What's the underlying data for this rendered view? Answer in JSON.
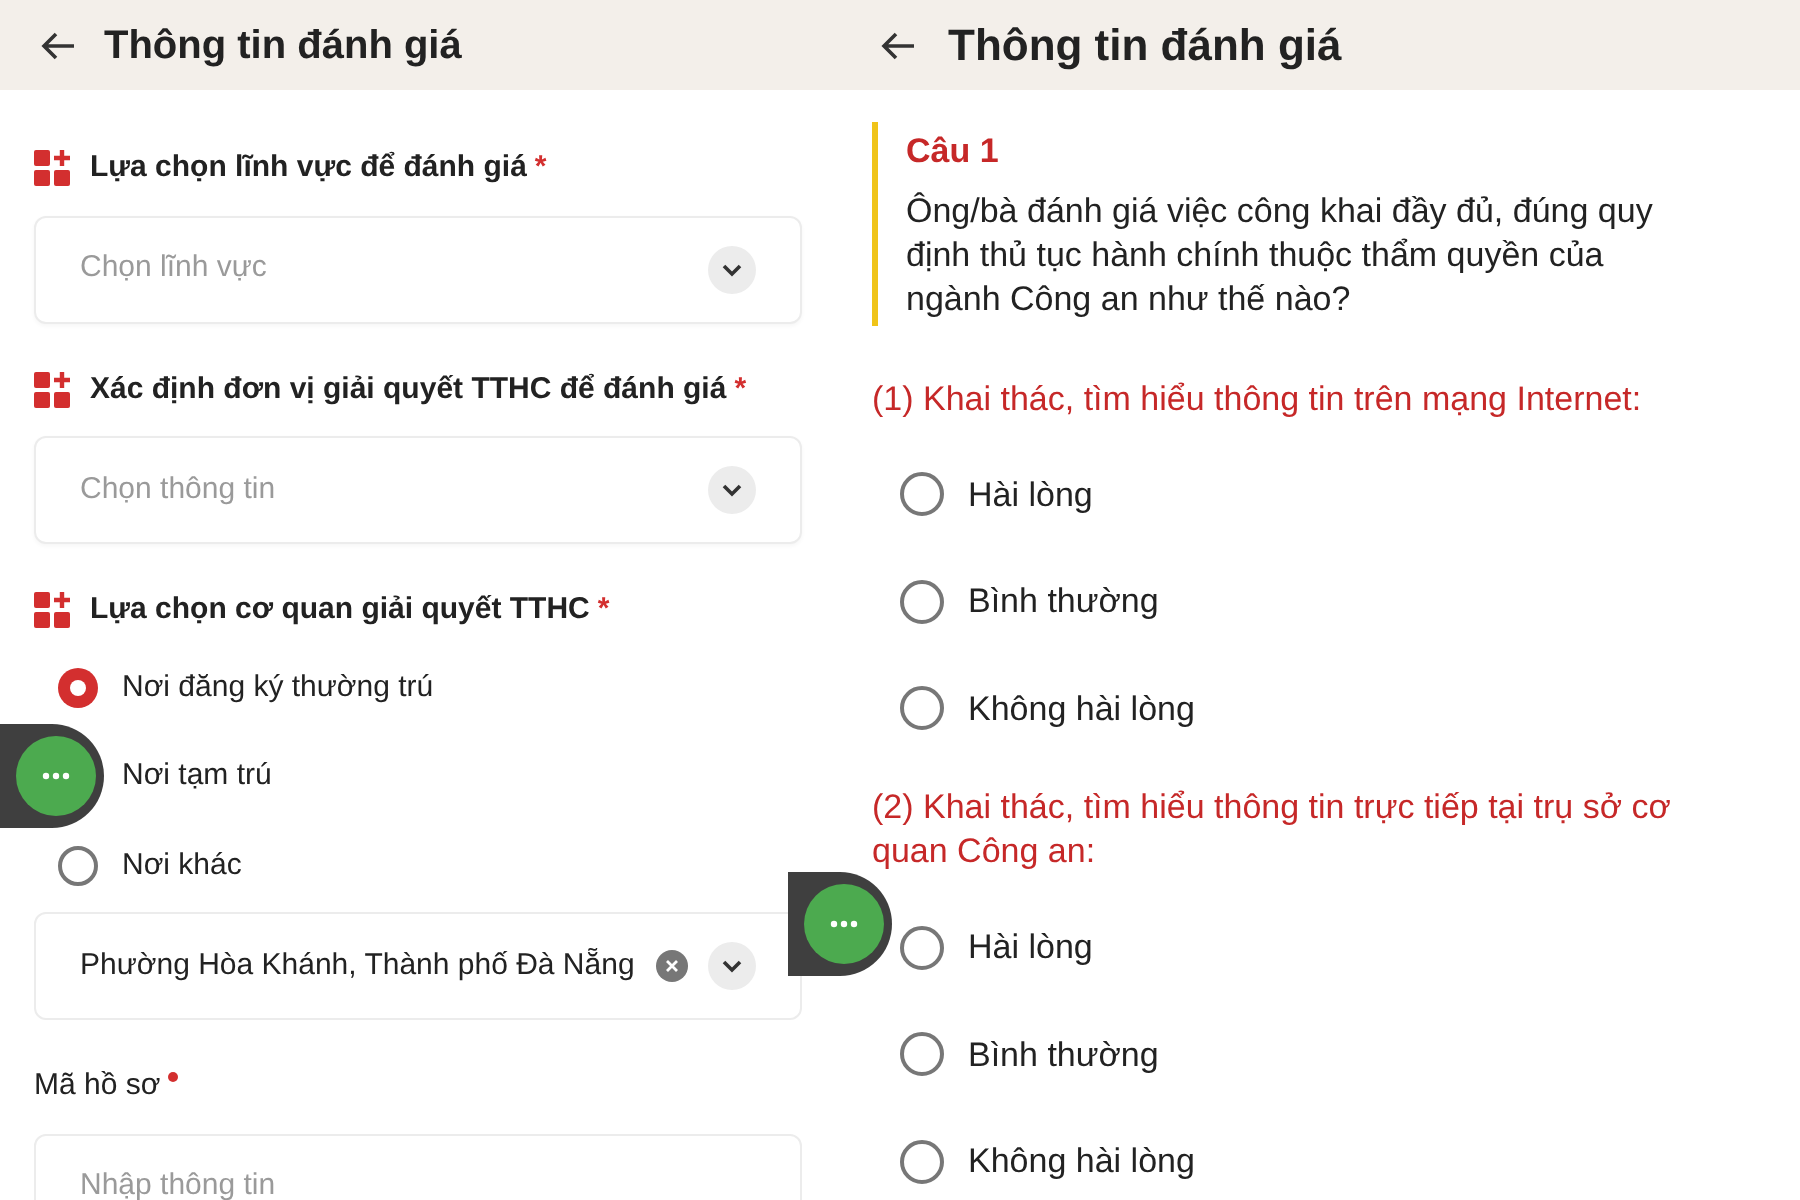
{
  "left": {
    "header": {
      "title": "Thông tin đánh giá"
    },
    "fields": [
      {
        "kind": "select",
        "label": "Lựa chọn lĩnh vực để đánh giá",
        "required_mark": "*",
        "placeholder": "Chọn lĩnh vực"
      },
      {
        "kind": "select",
        "label": "Xác định đơn vị giải quyết TTHC để đánh giá",
        "required_mark": "*",
        "placeholder": "Chọn thông tin"
      },
      {
        "kind": "radio",
        "label": "Lựa chọn cơ quan giải quyết TTHC",
        "required_mark": "*",
        "options": [
          {
            "label": "Nơi đăng ký thường trú",
            "selected": true
          },
          {
            "label": "Nơi tạm trú"
          },
          {
            "label": "Nơi khác",
            "selected": false
          }
        ]
      },
      {
        "kind": "chosen",
        "value": "Phường Hòa Khánh, Thành phố Đà Nẵng"
      },
      {
        "kind": "text",
        "label": "Mã hồ sơ",
        "required": true,
        "placeholder": "Nhập thông tin"
      }
    ]
  },
  "right": {
    "header": {
      "title": "Thông tin đánh giá"
    },
    "question": {
      "number": "Câu 1",
      "text": "Ông/bà đánh giá việc công khai đầy đủ, đúng quy định thủ tục hành chính thuộc thẩm quyền của ngành Công an như thế nào?"
    },
    "groups": [
      {
        "title": "(1) Khai thác, tìm hiểu thông tin trên mạng Internet:",
        "options": [
          {
            "label": "Hài lòng",
            "selected": false
          },
          {
            "label": "Bình thường",
            "selected": false
          },
          {
            "label": "Không hài lòng",
            "selected": false
          }
        ]
      },
      {
        "title": "(2) Khai thác, tìm hiểu thông tin trực tiếp tại trụ sở cơ quan Công an:",
        "options": [
          {
            "label": "Hài lòng",
            "selected": false
          },
          {
            "label": "Bình thường",
            "selected": false
          },
          {
            "label": "Không hài lòng",
            "selected": false
          }
        ]
      }
    ]
  }
}
